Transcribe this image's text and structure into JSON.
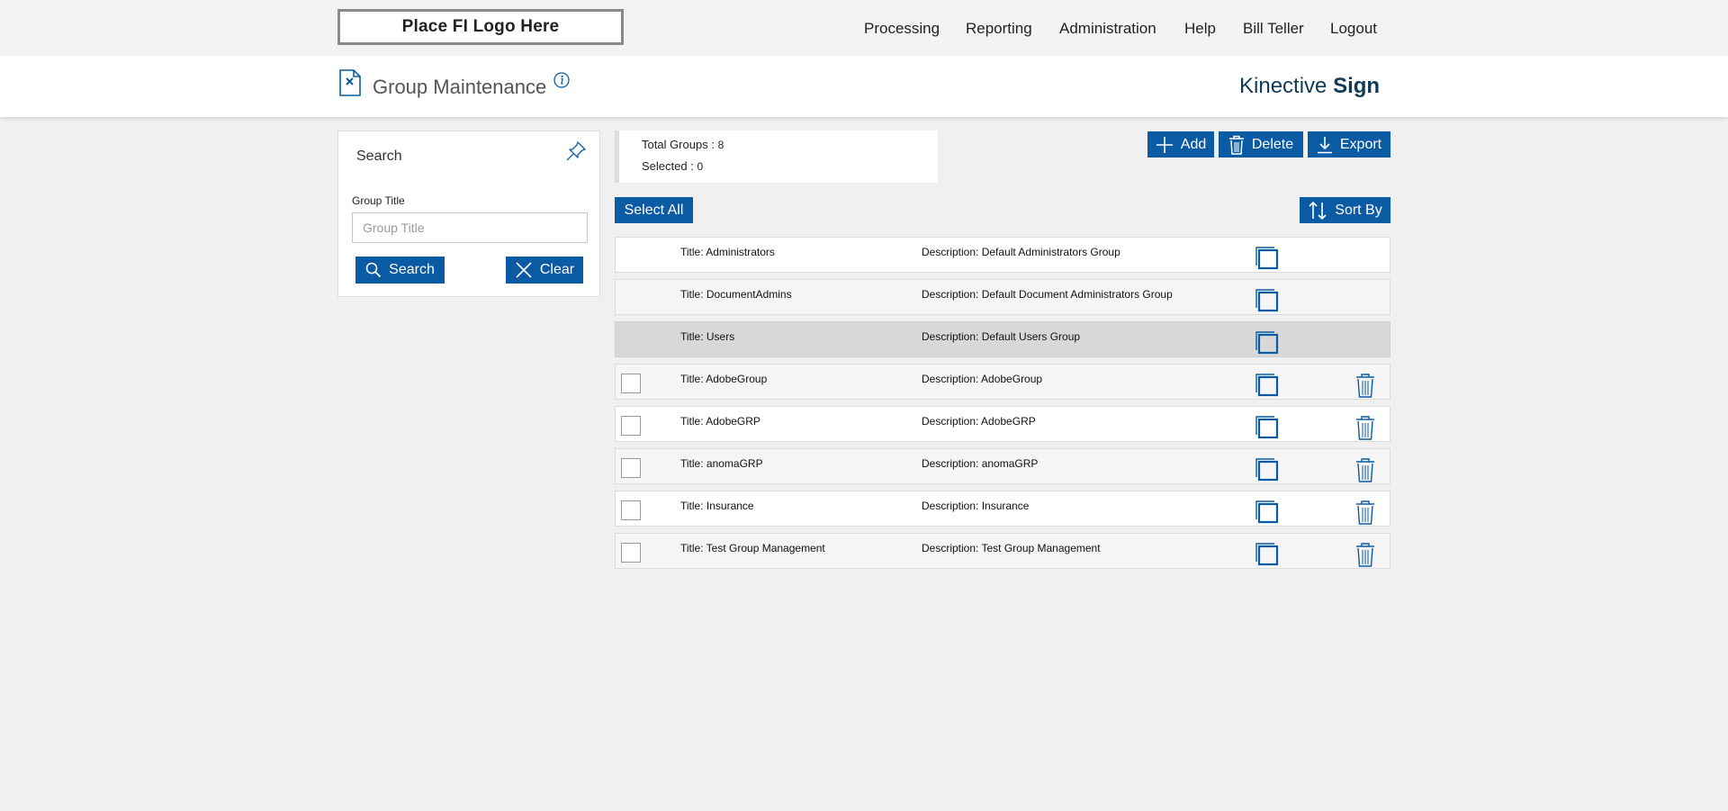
{
  "header": {
    "logo_text": "Place FI Logo Here",
    "nav": [
      "Processing",
      "Reporting",
      "Administration",
      "Help",
      "Bill Teller",
      "Logout"
    ]
  },
  "page": {
    "title": "Group Maintenance",
    "brand_light": "Kinective",
    "brand_bold": "Sign"
  },
  "search": {
    "title": "Search",
    "group_title_label": "Group Title",
    "group_title_placeholder": "Group Title",
    "group_title_value": "",
    "search_label": "Search",
    "clear_label": "Clear"
  },
  "stats": {
    "total_label": "Total Groups :",
    "total_value": "8",
    "selected_label": "Selected :",
    "selected_value": "0"
  },
  "toolbar": {
    "add_label": "Add",
    "delete_label": "Delete",
    "export_label": "Export",
    "select_all_label": "Select All",
    "sort_by_label": "Sort By"
  },
  "colors": {
    "accent": "#0b5aa4",
    "brand_text": "#0f3b58",
    "background": "#f0f0f0"
  },
  "rows": [
    {
      "title": "Title:  Administrators",
      "description": "Description: Default Administrators Group",
      "checkbox": false,
      "deletable": false,
      "selected": false
    },
    {
      "title": "Title:  DocumentAdmins",
      "description": "Description: Default Document Administrators Group",
      "checkbox": false,
      "deletable": false,
      "selected": false
    },
    {
      "title": "Title:  Users",
      "description": "Description: Default Users Group",
      "checkbox": false,
      "deletable": false,
      "selected": true
    },
    {
      "title": "Title:  AdobeGroup",
      "description": "Description: AdobeGroup",
      "checkbox": true,
      "deletable": true,
      "selected": false
    },
    {
      "title": "Title:  AdobeGRP",
      "description": "Description: AdobeGRP",
      "checkbox": true,
      "deletable": true,
      "selected": false
    },
    {
      "title": "Title:  anomaGRP",
      "description": "Description: anomaGRP",
      "checkbox": true,
      "deletable": true,
      "selected": false
    },
    {
      "title": "Title:  Insurance",
      "description": "Description: Insurance",
      "checkbox": true,
      "deletable": true,
      "selected": false
    },
    {
      "title": "Title:  Test Group Management",
      "description": "Description: Test Group Management",
      "checkbox": true,
      "deletable": true,
      "selected": false
    }
  ]
}
